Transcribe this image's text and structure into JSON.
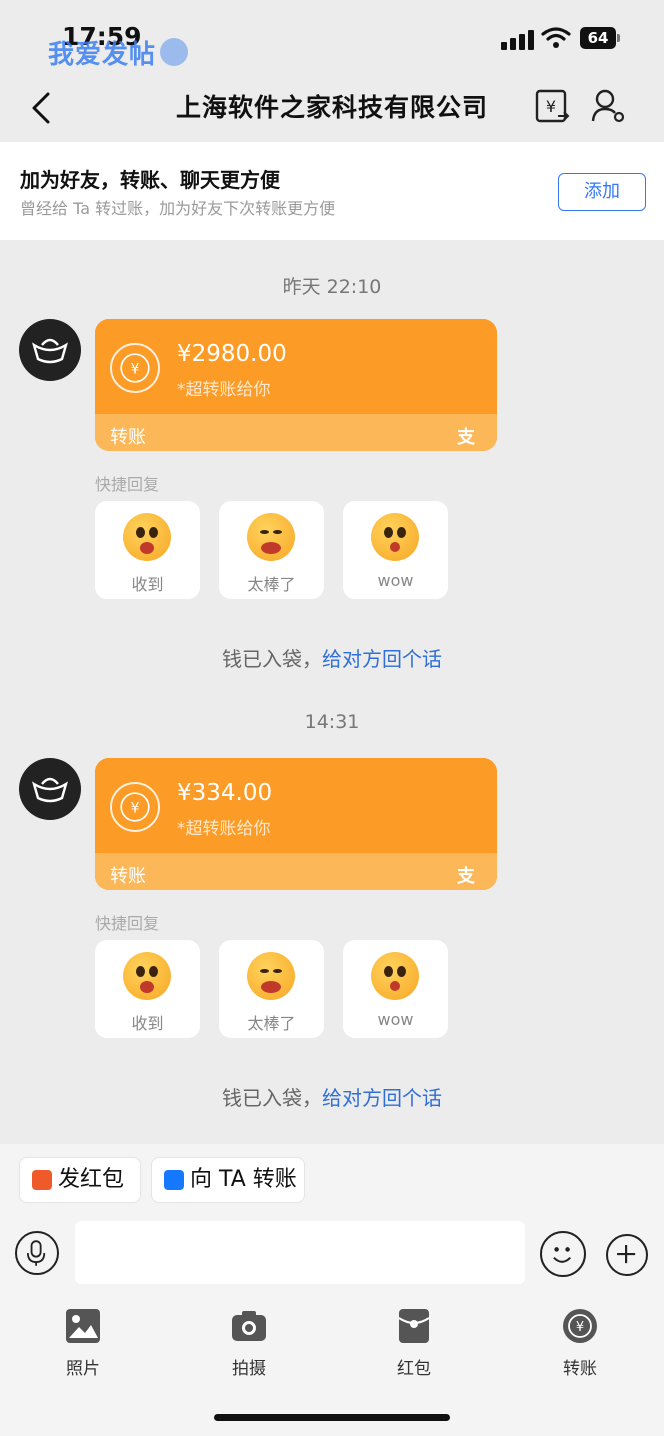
{
  "status_bar": {
    "time": "17:59",
    "battery": "64"
  },
  "watermark": {
    "text": "我爱发帖"
  },
  "header": {
    "title": "上海软件之家科技有限公司"
  },
  "banner": {
    "title": "加为好友，转账、聊天更方便",
    "subtitle": "曾经给 Ta 转过账，加为好友下次转账更方便",
    "add_label": "添加"
  },
  "messages": [
    {
      "timestamp": "昨天 22:10",
      "amount": "¥2980.00",
      "note": "*超转账给你",
      "card_label": "转账",
      "card_brand": "支",
      "quick_reply_label": "快捷回复",
      "quick_replies": [
        "收到",
        "太棒了",
        "wow"
      ],
      "status_text": "钱已入袋，",
      "status_link": "给对方回个话"
    },
    {
      "timestamp": "14:31",
      "amount": "¥334.00",
      "note": "*超转账给你",
      "card_label": "转账",
      "card_brand": "支",
      "quick_reply_label": "快捷回复",
      "quick_replies": [
        "收到",
        "太棒了",
        "wow"
      ],
      "status_text": "钱已入袋，",
      "status_link": "给对方回个话"
    }
  ],
  "quick_actions": {
    "red_packet": "发红包",
    "transfer_to": "向 TA 转账"
  },
  "toolbar": [
    {
      "label": "照片",
      "icon": "photo-icon"
    },
    {
      "label": "拍摄",
      "icon": "camera-icon"
    },
    {
      "label": "红包",
      "icon": "red-packet-icon"
    },
    {
      "label": "转账",
      "icon": "transfer-icon"
    }
  ],
  "colors": {
    "card_orange": "#fc9b25",
    "card_footer": "#fcb758",
    "link_blue": "#2f6fd6",
    "accent_blue": "#3478f6"
  }
}
